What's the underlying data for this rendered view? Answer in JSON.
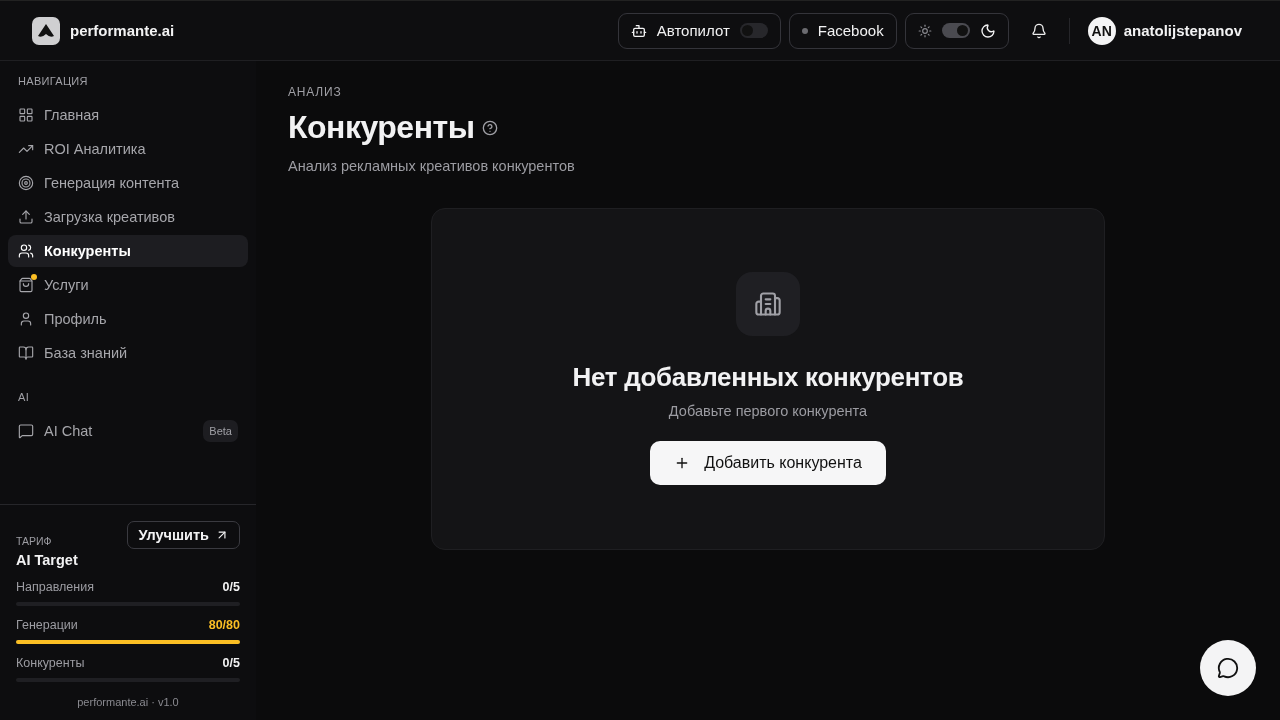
{
  "brand": {
    "name": "performante.ai"
  },
  "header": {
    "autopilot": {
      "label": "Автопилот",
      "on": false
    },
    "platform": {
      "label": "Facebook",
      "connected": false
    },
    "dark_mode": {
      "on": true
    },
    "user": {
      "initials": "AN",
      "name": "anatolijstepanov"
    }
  },
  "sidebar": {
    "sections": [
      {
        "title": "НАВИГАЦИЯ",
        "items": [
          {
            "label": "Главная",
            "selected": false,
            "notification": false
          },
          {
            "label": "ROI Аналитика",
            "selected": false,
            "notification": false
          },
          {
            "label": "Генерация контента",
            "selected": false,
            "notification": false
          },
          {
            "label": "Загрузка креативов",
            "selected": false,
            "notification": false
          },
          {
            "label": "Конкуренты",
            "selected": true,
            "notification": false
          },
          {
            "label": "Услуги",
            "selected": false,
            "notification": true
          },
          {
            "label": "Профиль",
            "selected": false,
            "notification": false
          },
          {
            "label": "База знаний",
            "selected": false,
            "notification": false
          }
        ]
      },
      {
        "title": "AI",
        "items": [
          {
            "label": "AI Chat",
            "selected": false,
            "notification": false,
            "badge": "Beta"
          }
        ]
      }
    ],
    "plan": {
      "caption": "ТАРИФ",
      "name": "AI Target",
      "upgrade": "Улучшить",
      "meters": [
        {
          "label": "Направления",
          "reading": "0/5",
          "level": 0
        },
        {
          "label": "Генерации",
          "reading": "80/80",
          "level": 1
        },
        {
          "label": "Конкуренты",
          "reading": "0/5",
          "level": 0
        }
      ]
    },
    "version": "performante.ai · v1.0"
  },
  "page": {
    "eyebrow": "АНАЛИЗ",
    "title": "Конкуренты",
    "subtitle": "Анализ рекламных креативов конкурентов",
    "empty": {
      "title": "Нет добавленных конкурентов",
      "text": "Добавьте первого конкурента",
      "button": "Добавить конкурента"
    }
  }
}
